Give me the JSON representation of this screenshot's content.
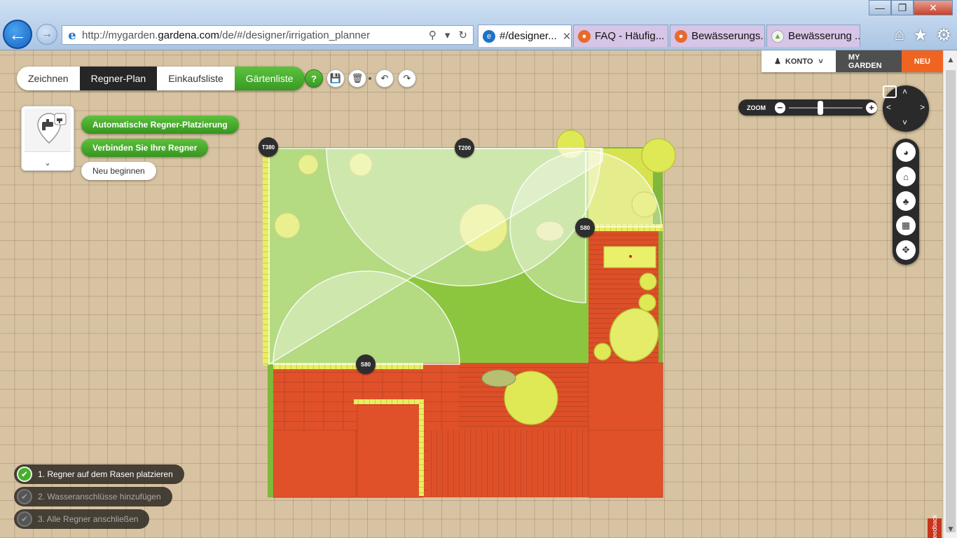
{
  "browser": {
    "url_prefix": "http://mygarden.",
    "url_domain": "gardena.com",
    "url_path": "/de/#/designer/irrigation_planner",
    "tabs": [
      {
        "label": "#/designer...",
        "active": true
      },
      {
        "label": "FAQ - Häufig...",
        "active": false
      },
      {
        "label": "Bewässerungs...",
        "active": false
      },
      {
        "label": "Bewässerung ...",
        "active": false
      }
    ]
  },
  "toolbar": {
    "tabs": [
      "Zeichnen",
      "Regner-Plan",
      "Einkaufsliste",
      "Gärtenliste"
    ],
    "help_label": "?"
  },
  "account": {
    "konto": "KONTO",
    "my_garden": "MY GARDEN",
    "neu": "NEU"
  },
  "actions": {
    "auto_place": "Automatische Regner-Platzierung",
    "connect": "Verbinden Sie Ihre Regner",
    "restart": "Neu beginnen"
  },
  "zoom": {
    "label": "ZOOM",
    "level": 0.42
  },
  "sprinklers": [
    {
      "label": "T380",
      "type": "turbo-sprinkler"
    },
    {
      "label": "T200",
      "type": "turbo-sprinkler"
    },
    {
      "label": "S80",
      "type": "sprinkler"
    },
    {
      "label": "S80",
      "type": "sprinkler"
    }
  ],
  "steps": [
    {
      "label": "1. Regner auf dem Rasen platzieren",
      "done": true
    },
    {
      "label": "2. Wasseranschlüsse hinzufügen",
      "done": false
    },
    {
      "label": "3. Alle Regner anschließen",
      "done": false
    }
  ],
  "feedback_label": "Feedback",
  "colors": {
    "lawn": "#8cc63f",
    "paving": "#e0512a",
    "accent_green": "#45b02a",
    "neu": "#f06422"
  }
}
